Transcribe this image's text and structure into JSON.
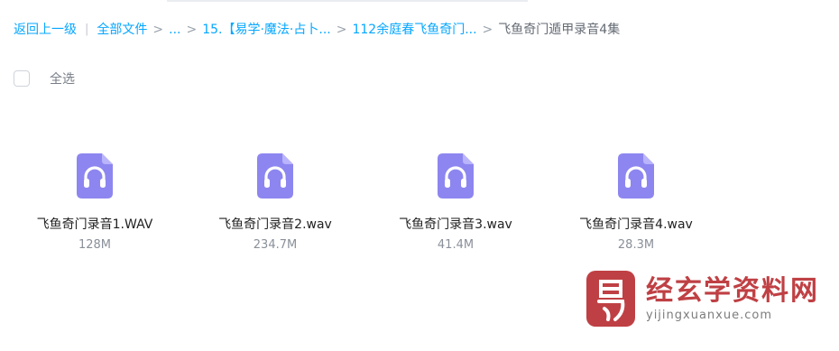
{
  "breadcrumb": {
    "back_label": "返回上一级",
    "root_label": "全部文件",
    "ellipsis_label": "...",
    "crumb_1": "15.【易学·魔法·占卜...",
    "crumb_2": "112余庭春飞鱼奇门...",
    "current": "飞鱼奇门遁甲录音4集"
  },
  "toolbar": {
    "select_all_label": "全选"
  },
  "files": [
    {
      "name": "飞鱼奇门录音1.WAV",
      "size": "128M",
      "icon": "audio-file-icon"
    },
    {
      "name": "飞鱼奇门录音2.wav",
      "size": "234.7M",
      "icon": "audio-file-icon"
    },
    {
      "name": "飞鱼奇门录音3.wav",
      "size": "41.4M",
      "icon": "audio-file-icon"
    },
    {
      "name": "飞鱼奇门录音4.wav",
      "size": "28.3M",
      "icon": "audio-file-icon"
    }
  ],
  "watermark": {
    "title": "经玄学资料网",
    "url": "yijingxuanxue.com"
  },
  "colors": {
    "link": "#06a7ff",
    "icon_bg": "#8d86f0",
    "watermark_red": "#b7262b"
  }
}
